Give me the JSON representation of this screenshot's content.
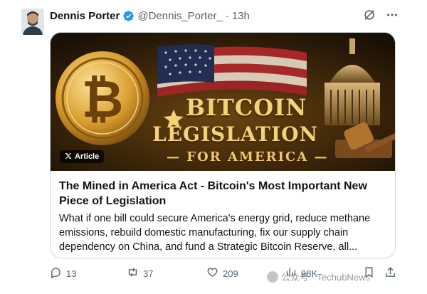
{
  "tweet": {
    "author_name": "Dennis Porter",
    "handle": "@Dennis_Porter_",
    "separator": "·",
    "time": "13h"
  },
  "header_icons": [
    "grok-icon",
    "more-icon"
  ],
  "card": {
    "badge": "Article",
    "banner_line1": "BITCOIN",
    "banner_line2": "LEGISLATION",
    "banner_line3": "— FOR AMERICA —",
    "title": "The Mined in America Act - Bitcoin's Most Important New Piece of Legislation",
    "description": "What if one bill could secure America's energy grid, reduce methane emissions, rebuild domestic manufacturing, fix our supply chain dependency on China, and fund a Strategic Bitcoin Reserve, all..."
  },
  "actions": {
    "replies": "13",
    "reposts": "37",
    "likes": "209",
    "views": "98K"
  },
  "watermark": {
    "text": "公众号 · TechubNews"
  },
  "colors": {
    "verified": "#1d9bf0",
    "muted": "#536471",
    "border": "#cfd9de",
    "gold": "#f3d27a"
  }
}
